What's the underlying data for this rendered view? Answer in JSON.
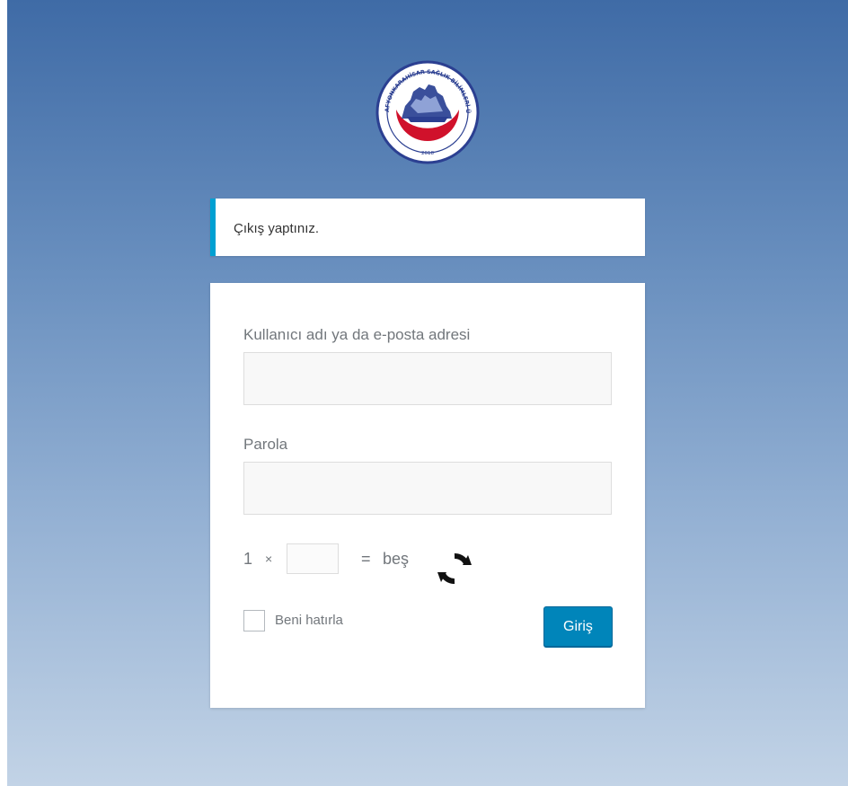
{
  "logo": {
    "text": "AFYONKARAHİSAR SAĞLIK BİLİMLERİ ÜNİVERSİTESİ",
    "year": "2018"
  },
  "notice": {
    "message": "Çıkış yaptınız."
  },
  "form": {
    "username_label": "Kullanıcı adı ya da e-posta adresi",
    "username_value": "",
    "password_label": "Parola",
    "password_value": "",
    "captcha": {
      "operand": "1",
      "operator": "×",
      "equals": "=",
      "result": "beş",
      "answer": ""
    },
    "remember_label": "Beni hatırla",
    "remember_checked": false,
    "submit_label": "Giriş"
  },
  "colors": {
    "accent": "#00a0d2",
    "button": "#0085ba",
    "logo_blue": "#2b3f91",
    "logo_red": "#d0112b"
  },
  "icons": {
    "refresh": "refresh-icon"
  }
}
